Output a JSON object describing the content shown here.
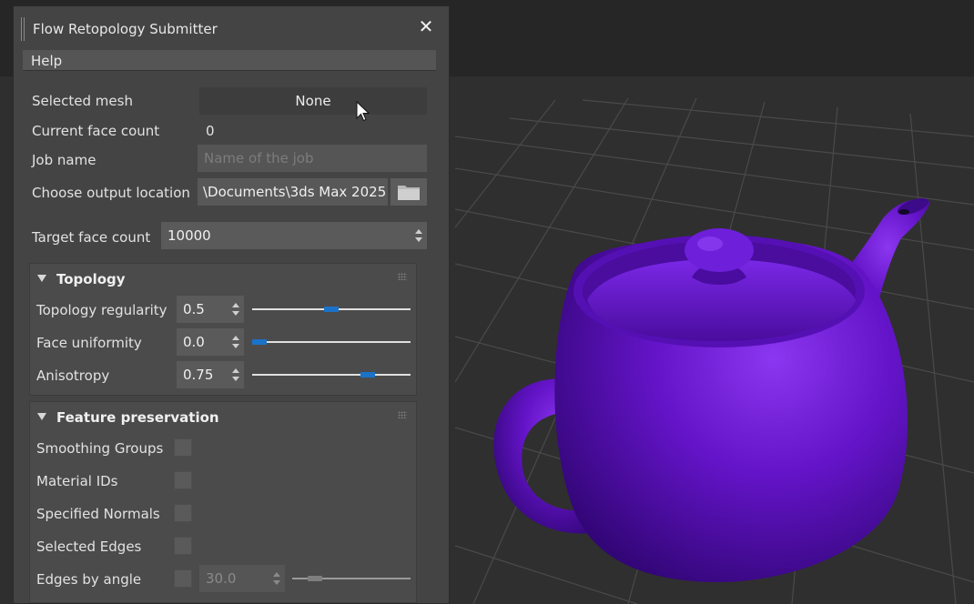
{
  "dialog": {
    "title": "Flow Retopology Submitter",
    "menu": {
      "help_label": "Help"
    },
    "fields": {
      "selected_mesh_label": "Selected mesh",
      "selected_mesh_value": "None",
      "current_face_count_label": "Current face count",
      "current_face_count_value": "0",
      "job_name_label": "Job name",
      "job_name_placeholder": "Name of the job",
      "output_location_label": "Choose output location",
      "output_location_value": "\\Documents\\3ds Max 2025",
      "target_face_count_label": "Target face count",
      "target_face_count_value": "10000"
    },
    "topology": {
      "heading": "Topology",
      "rows": [
        {
          "label": "Topology regularity",
          "value": "0.5",
          "level": 0.5
        },
        {
          "label": "Face uniformity",
          "value": "0.0",
          "level": 0.0
        },
        {
          "label": "Anisotropy",
          "value": "0.75",
          "level": 0.75
        }
      ]
    },
    "feature_preservation": {
      "heading": "Feature preservation",
      "checkboxes": [
        {
          "label": "Smoothing Groups",
          "checked": false
        },
        {
          "label": "Material IDs",
          "checked": false
        },
        {
          "label": "Specified Normals",
          "checked": false
        },
        {
          "label": "Selected Edges",
          "checked": false
        },
        {
          "label": "Edges by angle",
          "checked": false
        }
      ],
      "edges_by_angle_value": "30.0",
      "edges_by_angle_level": 0.15
    }
  },
  "colors": {
    "slider_accent": "#1a73c9",
    "teapot": "#5a10b8",
    "panel_bg": "#444444"
  },
  "icons": [
    "close-icon",
    "folder-icon",
    "mouse-cursor-icon",
    "collapse-triangle-icon",
    "spinner-arrows-icon"
  ]
}
